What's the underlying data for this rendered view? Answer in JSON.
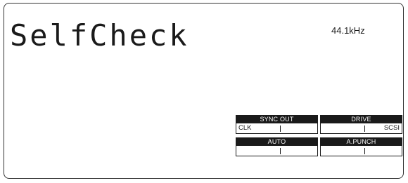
{
  "display": {
    "main_text": "SelfCheck",
    "sample_rate": "44.1kHz"
  },
  "status_boxes": [
    {
      "label": "SYNC OUT",
      "left_value": "CLK",
      "right_value": ""
    },
    {
      "label": "DRIVE",
      "left_value": "",
      "right_value": "SCSI"
    },
    {
      "label": "AUTO",
      "left_value": "",
      "right_value": ""
    },
    {
      "label": "A.PUNCH",
      "left_value": "",
      "right_value": ""
    }
  ]
}
